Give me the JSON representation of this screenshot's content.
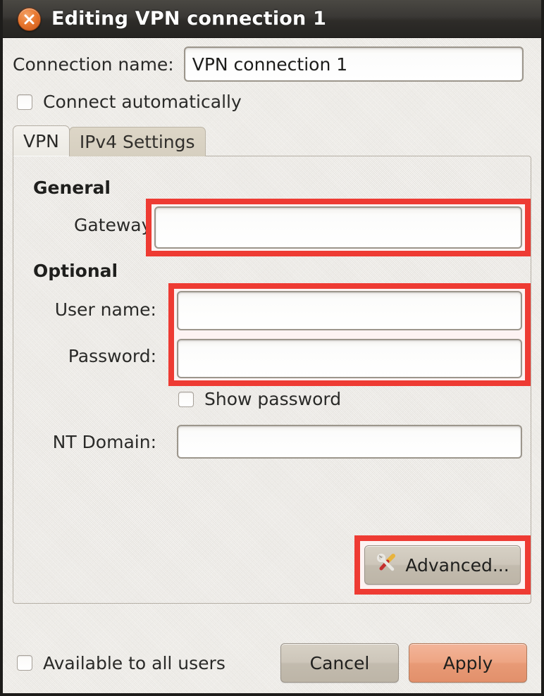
{
  "window": {
    "title": "Editing VPN connection 1",
    "close_icon": "close-x-icon"
  },
  "connection": {
    "name_label": "Connection name:",
    "name_value": "VPN connection 1",
    "name_placeholder": "",
    "connect_automatically_label": "Connect automatically",
    "connect_automatically_checked": false
  },
  "tabs": [
    {
      "label": "VPN",
      "active": true
    },
    {
      "label": "IPv4 Settings",
      "active": false
    }
  ],
  "vpn_tab": {
    "general": {
      "heading": "General",
      "gateway_label": "Gateway:",
      "gateway_value": "",
      "gateway_placeholder": ""
    },
    "optional": {
      "heading": "Optional",
      "username_label": "User name:",
      "username_value": "",
      "username_placeholder": "",
      "password_label": "Password:",
      "password_value": "",
      "password_placeholder": "",
      "show_password_label": "Show password",
      "show_password_checked": false,
      "nt_domain_label": "NT Domain:",
      "nt_domain_value": "",
      "nt_domain_placeholder": ""
    },
    "advanced_button_label": "Advanced...",
    "advanced_button_icon": "tools-icon"
  },
  "footer": {
    "available_to_all_label": "Available to all users",
    "available_to_all_checked": false,
    "cancel_label": "Cancel",
    "apply_label": "Apply"
  },
  "colors": {
    "annotation_red": "#ee3b33",
    "titlebar_dark": "#3a3835",
    "close_orange": "#e8762d",
    "apply_salmon": "#ee a583",
    "window_bg": "#ece9e3"
  }
}
